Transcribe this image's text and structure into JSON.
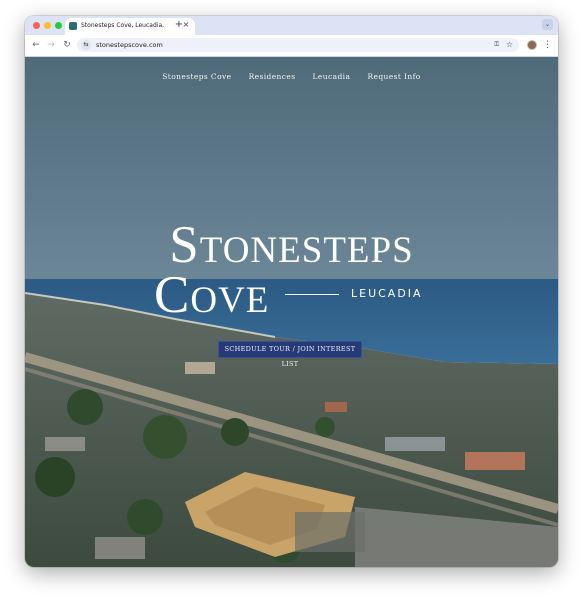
{
  "browser": {
    "tab_title": "Stonesteps Cove, Leucadia,",
    "url": "stonestepscove.com",
    "tab_close_glyph": "×",
    "new_tab_glyph": "+",
    "back_glyph": "←",
    "forward_glyph": "→",
    "reload_glyph": "↻",
    "tab_search_glyph": "⌄",
    "menu_glyph": "⋮",
    "star_glyph": "☆",
    "key_glyph": "⚿",
    "site_info_glyph": "⇆",
    "icons": [
      "favicon",
      "close-icon",
      "plus-icon",
      "back-arrow-icon",
      "forward-arrow-icon",
      "reload-icon",
      "site-info-icon",
      "password-key-icon",
      "bookmark-star-icon",
      "profile-avatar",
      "more-menu-icon",
      "tab-search-chevron-icon"
    ]
  },
  "nav": {
    "items": [
      "Stonesteps Cove",
      "Residences",
      "Leucadia",
      "Request Info"
    ]
  },
  "hero": {
    "brand_line1": "Stonesteps",
    "brand_line2": "Cove",
    "brand_sub": "LEUCADIA",
    "cta_label": "SCHEDULE TOUR / JOIN INTEREST LIST"
  },
  "colors": {
    "sky": "#577281",
    "ocean": "#2e5d87",
    "cta": "#263a78",
    "text": "#ffffff"
  }
}
